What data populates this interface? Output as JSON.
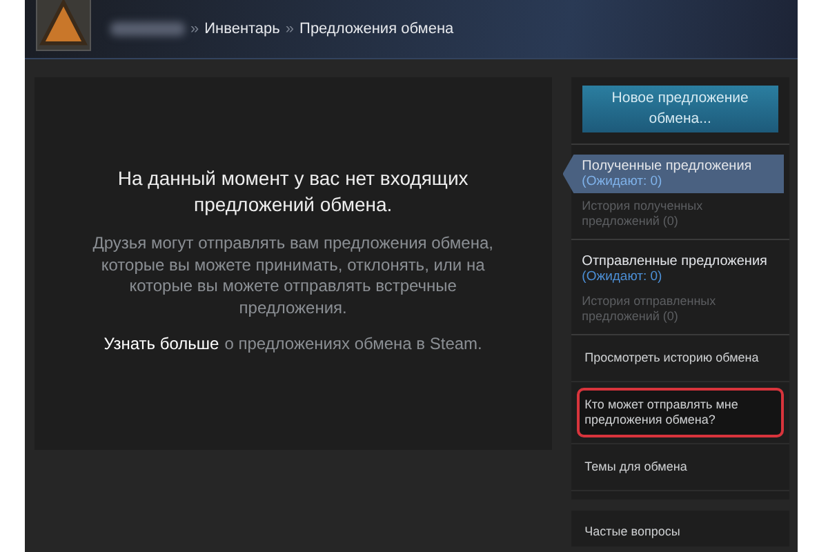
{
  "header": {
    "breadcrumb": [
      {
        "separator": "»",
        "label": "Инвентарь"
      },
      {
        "separator": "»",
        "label": "Предложения обмена"
      }
    ]
  },
  "main": {
    "title": "На данный момент у вас нет входящих предложений обмена.",
    "description": "Друзья могут отправлять вам предложения обмена, которые вы можете принимать, отклонять, или на которые вы можете отправлять встречные предложения.",
    "learn_more": {
      "link": "Узнать больше",
      "text": "о предложениях обмена в Steam."
    }
  },
  "sidebar": {
    "items": [
      {
        "kind": "button",
        "label": "Новое предложение обмена..."
      },
      {
        "kind": "group",
        "title": "Полученные предложения",
        "pending": "(Ожидают: 0)",
        "history": "История полученных предложений (0)",
        "selected": true
      },
      {
        "kind": "group",
        "title": "Отправленные предложения",
        "pending": "(Ожидают: 0)",
        "history": "История отправленных предложений (0)",
        "selected": false
      },
      {
        "kind": "link",
        "label": "Просмотреть историю обмена",
        "highlighted": false
      },
      {
        "kind": "link",
        "label": "Кто может отправлять мне предложения обмена?",
        "highlighted": true
      },
      {
        "kind": "link",
        "label": "Темы для обмена",
        "highlighted": false
      }
    ],
    "faq": "Частые вопросы"
  }
}
